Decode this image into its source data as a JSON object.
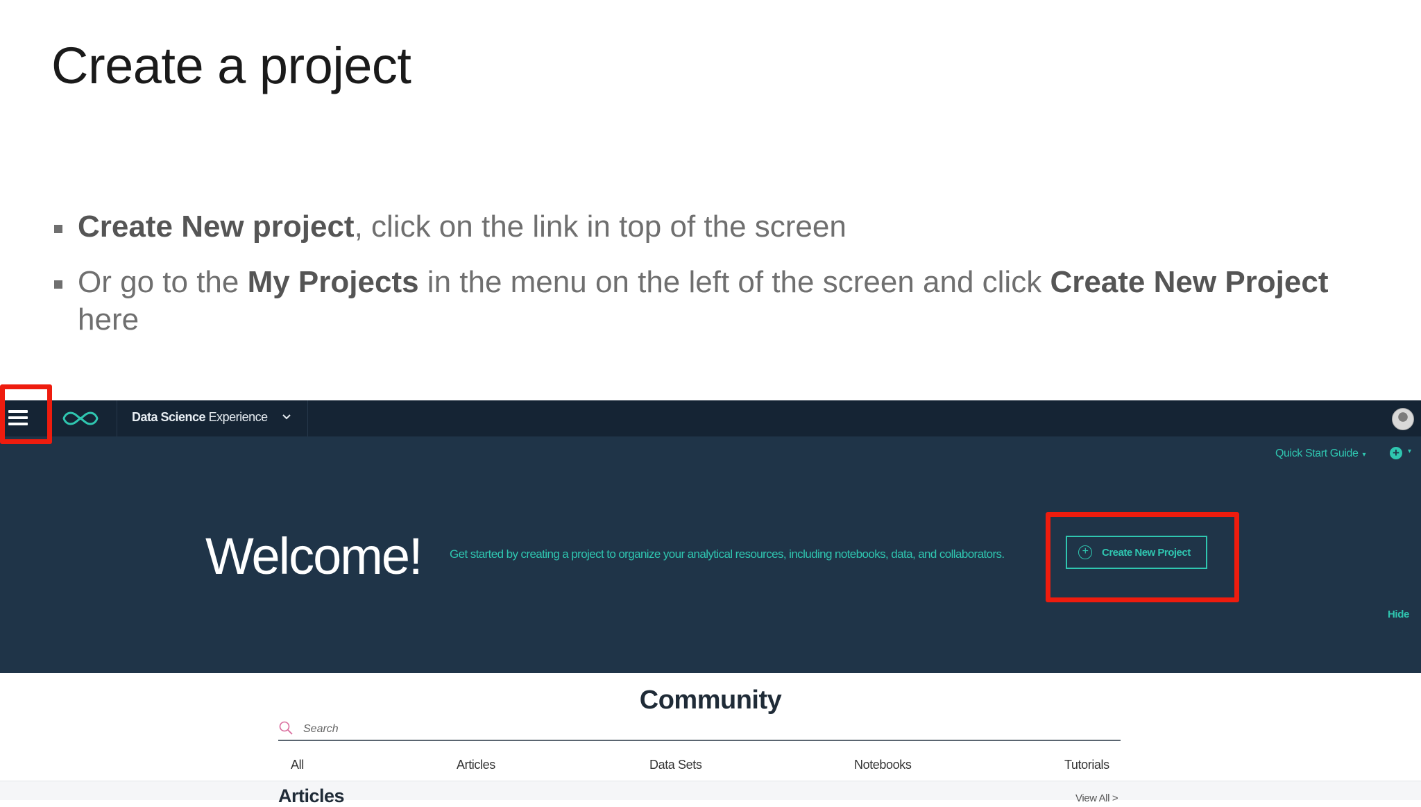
{
  "slide": {
    "title": "Create a project",
    "bullet1": {
      "bold": "Create New project",
      "rest": ", click on the link in top of the screen"
    },
    "bullet2": {
      "t1": "Or go to the ",
      "b1": "My Projects",
      "t2": " in the menu on the left of the screen and click ",
      "b2": "Create New Project",
      "t3": " here"
    }
  },
  "app": {
    "name_bold": "Data Science",
    "name_rest": " Experience",
    "quick_start": "Quick Start Guide",
    "welcome": "Welcome!",
    "tagline": "Get started by creating a project to organize your analytical resources, including notebooks, data, and collaborators.",
    "create_button": "Create New Project",
    "hide": "Hide",
    "community": {
      "title": "Community",
      "search_placeholder": "Search",
      "filters": [
        "All",
        "Articles",
        "Data Sets",
        "Notebooks",
        "Tutorials"
      ],
      "articles_title": "Articles",
      "view_all": "View All >"
    }
  },
  "colors": {
    "topbar": "#152434",
    "hero": "#1f3448",
    "accent": "#2fc6b0",
    "highlight": "#ee1c0e"
  }
}
